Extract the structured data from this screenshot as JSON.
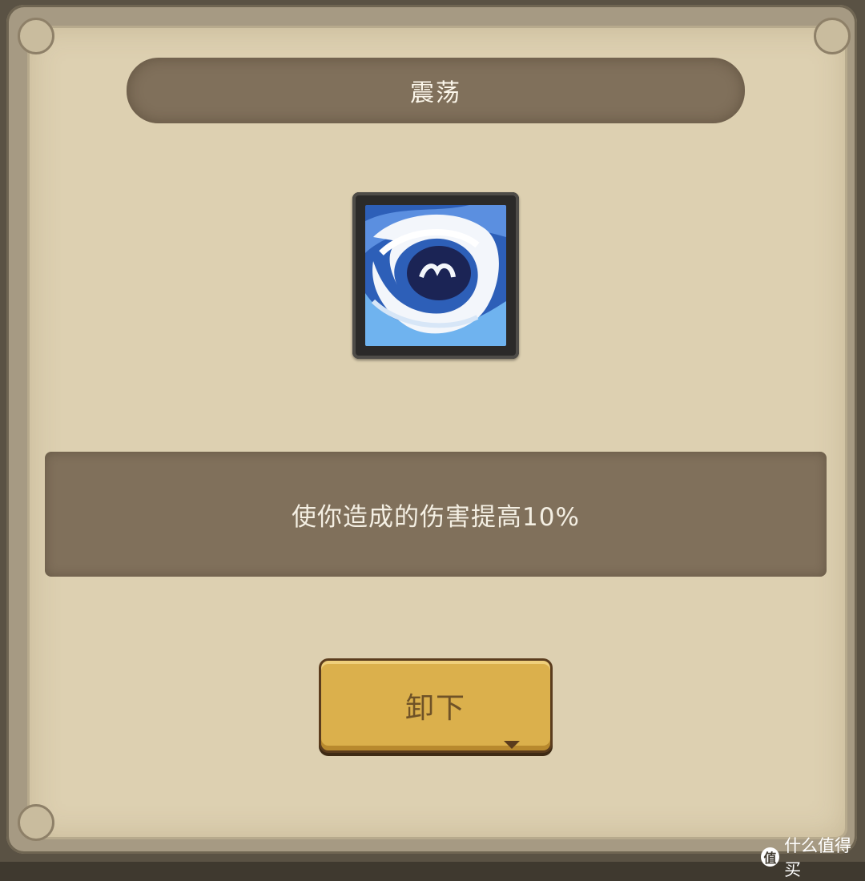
{
  "dialog": {
    "title": "震荡",
    "skill_icon": "water-vortex-icon",
    "description": "使你造成的伤害提高10%",
    "unequip_button_label": "卸下"
  },
  "watermark": {
    "logo_char": "值",
    "text": "什么值得买"
  },
  "colors": {
    "panel_bg": "#ddd0b1",
    "banner_bg": "#80705b",
    "button_bg": "#dbb04c",
    "button_text": "#6f5227"
  }
}
